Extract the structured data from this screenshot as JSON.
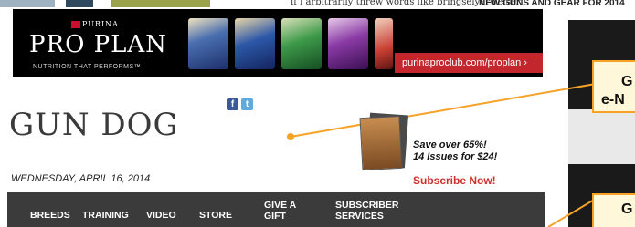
{
  "top_strip": {
    "snippet": "if i arbitrarily threw words like bringselyerweiser",
    "headline": "NEW GUNS AND GEAR FOR 2014"
  },
  "ad": {
    "brand": "PURINA",
    "product": "PRO PLAN",
    "tagline": "NUTRITION THAT PERFORMS™",
    "cta": "purinaproclub.com/proplan ›",
    "colors": {
      "background": "#000000",
      "cta": "#c4262e"
    }
  },
  "social": {
    "facebook": "f",
    "twitter": "t"
  },
  "masthead": {
    "logo": "GUN DOG",
    "date": "WEDNESDAY, APRIL 16, 2014"
  },
  "promo": {
    "line1": "Save over 65%!",
    "line2": "14 Issues for $24!",
    "cta": "Subscribe Now!",
    "cta_color": "#d0302b"
  },
  "nav": {
    "breeds": "BREEDS",
    "training": "TRAINING",
    "video": "VIDEO",
    "store": "STORE",
    "give_gift_1": "GIVE A",
    "give_gift_2": "GIFT",
    "subscriber_1": "SUBSCRIBER",
    "subscriber_2": "SERVICES",
    "background": "#3b3b3b"
  },
  "callouts": {
    "first_1": "G",
    "first_2": "e-N",
    "second_1": "G",
    "border_color": "#f5a227"
  }
}
